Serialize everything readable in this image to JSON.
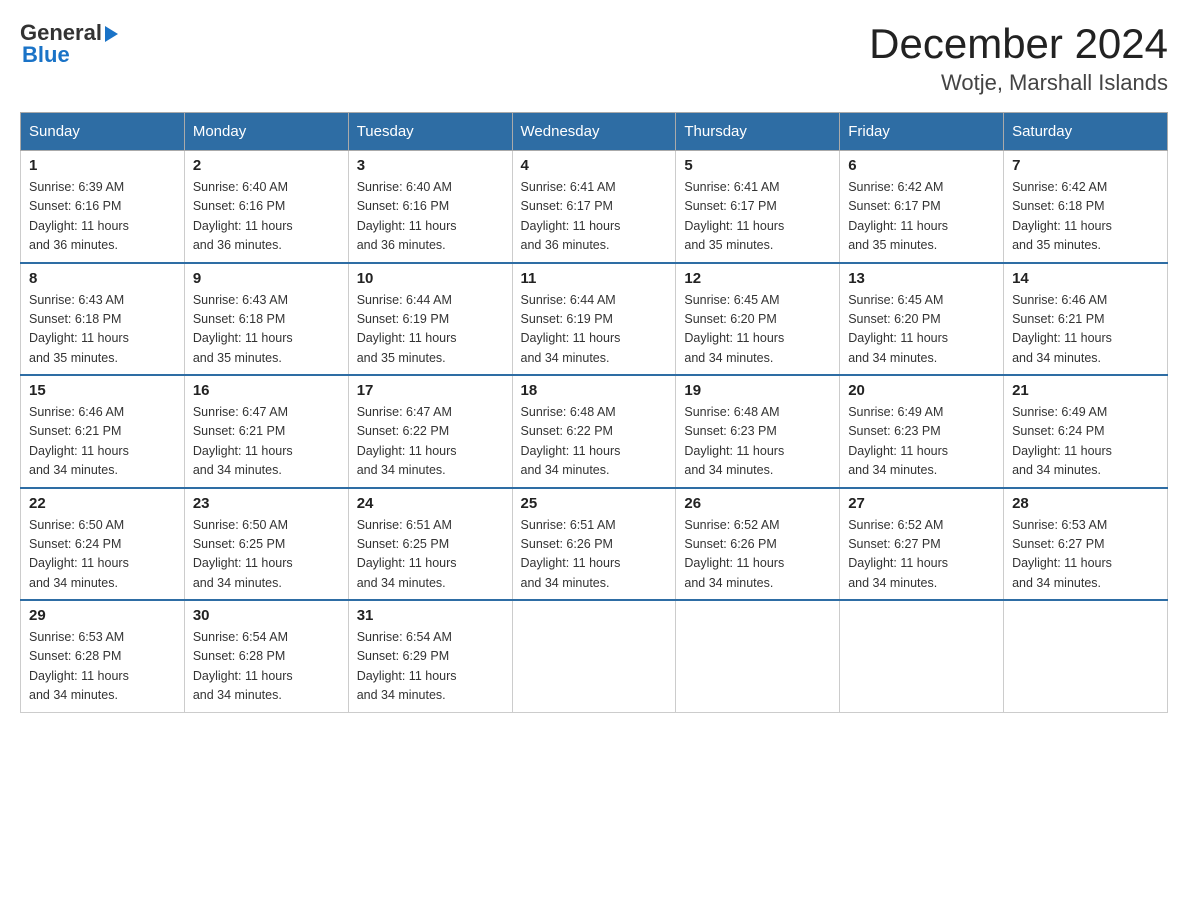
{
  "logo": {
    "general": "General",
    "blue": "Blue"
  },
  "title": "December 2024",
  "location": "Wotje, Marshall Islands",
  "days_of_week": [
    "Sunday",
    "Monday",
    "Tuesday",
    "Wednesday",
    "Thursday",
    "Friday",
    "Saturday"
  ],
  "weeks": [
    [
      {
        "day": "1",
        "sunrise": "6:39 AM",
        "sunset": "6:16 PM",
        "daylight": "11 hours and 36 minutes."
      },
      {
        "day": "2",
        "sunrise": "6:40 AM",
        "sunset": "6:16 PM",
        "daylight": "11 hours and 36 minutes."
      },
      {
        "day": "3",
        "sunrise": "6:40 AM",
        "sunset": "6:16 PM",
        "daylight": "11 hours and 36 minutes."
      },
      {
        "day": "4",
        "sunrise": "6:41 AM",
        "sunset": "6:17 PM",
        "daylight": "11 hours and 36 minutes."
      },
      {
        "day": "5",
        "sunrise": "6:41 AM",
        "sunset": "6:17 PM",
        "daylight": "11 hours and 35 minutes."
      },
      {
        "day": "6",
        "sunrise": "6:42 AM",
        "sunset": "6:17 PM",
        "daylight": "11 hours and 35 minutes."
      },
      {
        "day": "7",
        "sunrise": "6:42 AM",
        "sunset": "6:18 PM",
        "daylight": "11 hours and 35 minutes."
      }
    ],
    [
      {
        "day": "8",
        "sunrise": "6:43 AM",
        "sunset": "6:18 PM",
        "daylight": "11 hours and 35 minutes."
      },
      {
        "day": "9",
        "sunrise": "6:43 AM",
        "sunset": "6:18 PM",
        "daylight": "11 hours and 35 minutes."
      },
      {
        "day": "10",
        "sunrise": "6:44 AM",
        "sunset": "6:19 PM",
        "daylight": "11 hours and 35 minutes."
      },
      {
        "day": "11",
        "sunrise": "6:44 AM",
        "sunset": "6:19 PM",
        "daylight": "11 hours and 34 minutes."
      },
      {
        "day": "12",
        "sunrise": "6:45 AM",
        "sunset": "6:20 PM",
        "daylight": "11 hours and 34 minutes."
      },
      {
        "day": "13",
        "sunrise": "6:45 AM",
        "sunset": "6:20 PM",
        "daylight": "11 hours and 34 minutes."
      },
      {
        "day": "14",
        "sunrise": "6:46 AM",
        "sunset": "6:21 PM",
        "daylight": "11 hours and 34 minutes."
      }
    ],
    [
      {
        "day": "15",
        "sunrise": "6:46 AM",
        "sunset": "6:21 PM",
        "daylight": "11 hours and 34 minutes."
      },
      {
        "day": "16",
        "sunrise": "6:47 AM",
        "sunset": "6:21 PM",
        "daylight": "11 hours and 34 minutes."
      },
      {
        "day": "17",
        "sunrise": "6:47 AM",
        "sunset": "6:22 PM",
        "daylight": "11 hours and 34 minutes."
      },
      {
        "day": "18",
        "sunrise": "6:48 AM",
        "sunset": "6:22 PM",
        "daylight": "11 hours and 34 minutes."
      },
      {
        "day": "19",
        "sunrise": "6:48 AM",
        "sunset": "6:23 PM",
        "daylight": "11 hours and 34 minutes."
      },
      {
        "day": "20",
        "sunrise": "6:49 AM",
        "sunset": "6:23 PM",
        "daylight": "11 hours and 34 minutes."
      },
      {
        "day": "21",
        "sunrise": "6:49 AM",
        "sunset": "6:24 PM",
        "daylight": "11 hours and 34 minutes."
      }
    ],
    [
      {
        "day": "22",
        "sunrise": "6:50 AM",
        "sunset": "6:24 PM",
        "daylight": "11 hours and 34 minutes."
      },
      {
        "day": "23",
        "sunrise": "6:50 AM",
        "sunset": "6:25 PM",
        "daylight": "11 hours and 34 minutes."
      },
      {
        "day": "24",
        "sunrise": "6:51 AM",
        "sunset": "6:25 PM",
        "daylight": "11 hours and 34 minutes."
      },
      {
        "day": "25",
        "sunrise": "6:51 AM",
        "sunset": "6:26 PM",
        "daylight": "11 hours and 34 minutes."
      },
      {
        "day": "26",
        "sunrise": "6:52 AM",
        "sunset": "6:26 PM",
        "daylight": "11 hours and 34 minutes."
      },
      {
        "day": "27",
        "sunrise": "6:52 AM",
        "sunset": "6:27 PM",
        "daylight": "11 hours and 34 minutes."
      },
      {
        "day": "28",
        "sunrise": "6:53 AM",
        "sunset": "6:27 PM",
        "daylight": "11 hours and 34 minutes."
      }
    ],
    [
      {
        "day": "29",
        "sunrise": "6:53 AM",
        "sunset": "6:28 PM",
        "daylight": "11 hours and 34 minutes."
      },
      {
        "day": "30",
        "sunrise": "6:54 AM",
        "sunset": "6:28 PM",
        "daylight": "11 hours and 34 minutes."
      },
      {
        "day": "31",
        "sunrise": "6:54 AM",
        "sunset": "6:29 PM",
        "daylight": "11 hours and 34 minutes."
      },
      null,
      null,
      null,
      null
    ]
  ],
  "labels": {
    "sunrise": "Sunrise:",
    "sunset": "Sunset:",
    "daylight": "Daylight:"
  }
}
